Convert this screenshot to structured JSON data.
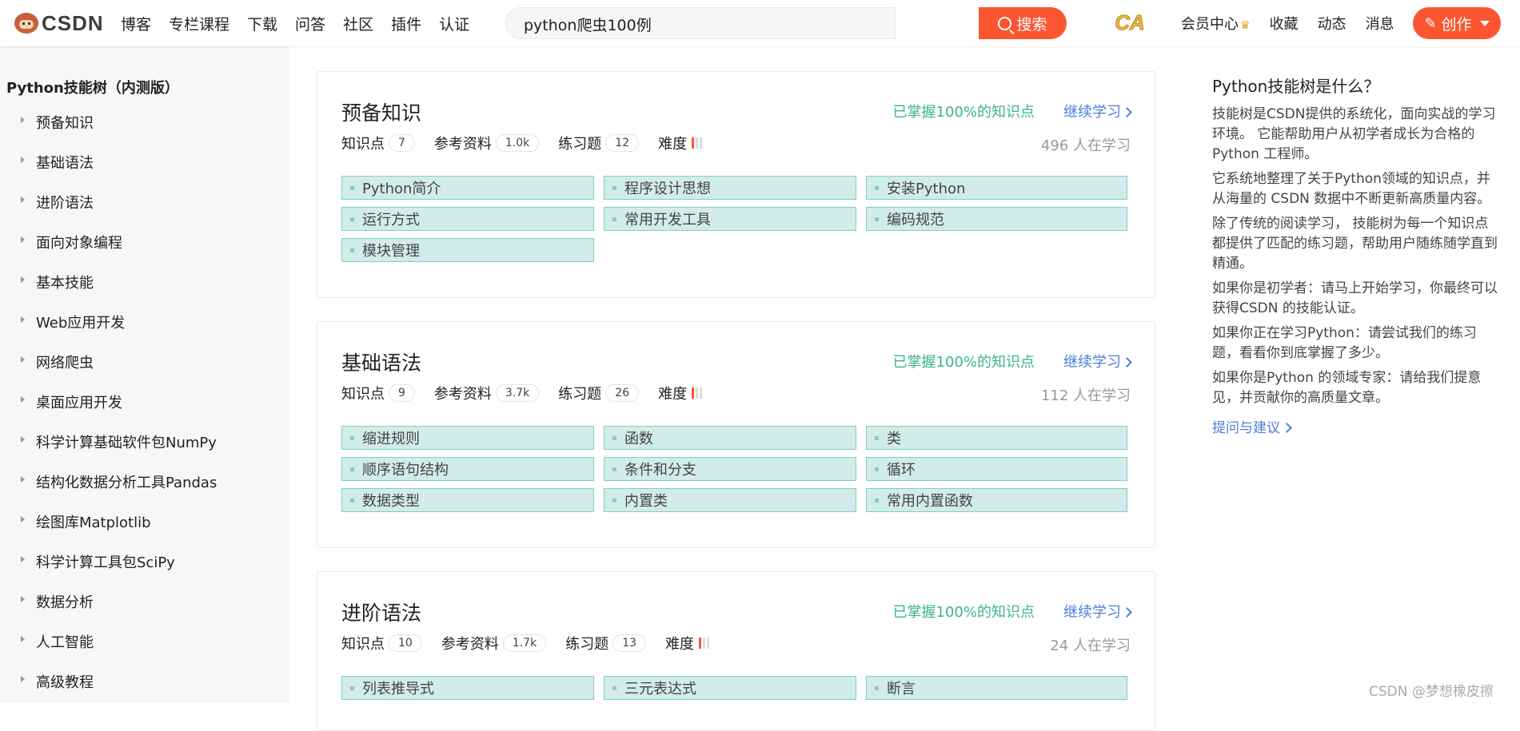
{
  "header": {
    "logo_text": "CSDN",
    "nav": [
      "博客",
      "专栏课程",
      "下载",
      "问答",
      "社区",
      "插件",
      "认证"
    ],
    "search_value": "python爬虫100例",
    "search_button": "搜索",
    "avatar_text": "CA",
    "right_nav": [
      "会员中心",
      "收藏",
      "动态",
      "消息"
    ],
    "create_button": "创作"
  },
  "sidebar": {
    "title": "Python技能树（内测版）",
    "items": [
      "预备知识",
      "基础语法",
      "进阶语法",
      "面向对象编程",
      "基本技能",
      "Web应用开发",
      "网络爬虫",
      "桌面应用开发",
      "科学计算基础软件包NumPy",
      "结构化数据分析工具Pandas",
      "绘图库Matplotlib",
      "科学计算工具包SciPy",
      "数据分析",
      "人工智能",
      "高级教程"
    ]
  },
  "labels": {
    "knowledge": "知识点",
    "references": "参考资料",
    "exercises": "练习题",
    "difficulty": "难度",
    "mastered": "已掌握100%的知识点",
    "continue": "继续学习"
  },
  "cards": [
    {
      "title": "预备知识",
      "knowledge_count": "7",
      "reference_count": "1.0k",
      "exercise_count": "12",
      "difficulty_level": 1,
      "learners": "496 人在学习",
      "chips": [
        "Python简介",
        "程序设计思想",
        "安装Python",
        "运行方式",
        "常用开发工具",
        "编码规范",
        "模块管理"
      ]
    },
    {
      "title": "基础语法",
      "knowledge_count": "9",
      "reference_count": "3.7k",
      "exercise_count": "26",
      "difficulty_level": 1,
      "learners": "112 人在学习",
      "chips": [
        "缩进规则",
        "函数",
        "类",
        "顺序语句结构",
        "条件和分支",
        "循环",
        "数据类型",
        "内置类",
        "常用内置函数"
      ]
    },
    {
      "title": "进阶语法",
      "knowledge_count": "10",
      "reference_count": "1.7k",
      "exercise_count": "13",
      "difficulty_level": 1,
      "learners": "24 人在学习",
      "chips": [
        "列表推导式",
        "三元表达式",
        "断言"
      ]
    }
  ],
  "right_panel": {
    "title": "Python技能树是什么？",
    "paragraphs": [
      "技能树是CSDN提供的系统化，面向实战的学习环境。 它能帮助用户从初学者成长为合格的 Python 工程师。",
      "它系统地整理了关于Python领域的知识点，并从海量的 CSDN 数据中不断更新高质量内容。",
      "除了传统的阅读学习， 技能树为每一个知识点都提供了匹配的练习题，帮助用户随练随学直到精通。",
      "如果你是初学者：请马上开始学习，你最终可以获得CSDN 的技能认证。",
      "如果你正在学习Python：请尝试我们的练习题，看看你到底掌握了多少。",
      "如果你是Python 的领域专家：请给我们提意见，并贡献你的高质量文章。"
    ],
    "link": "提问与建议"
  },
  "watermark": "CSDN @梦想橡皮擦",
  "colors": {
    "accent": "#fc5531",
    "mastered": "#3bb585",
    "link": "#4b7ed8",
    "chip_bg": "#d2ece9",
    "chip_border": "#7fcfc4"
  }
}
